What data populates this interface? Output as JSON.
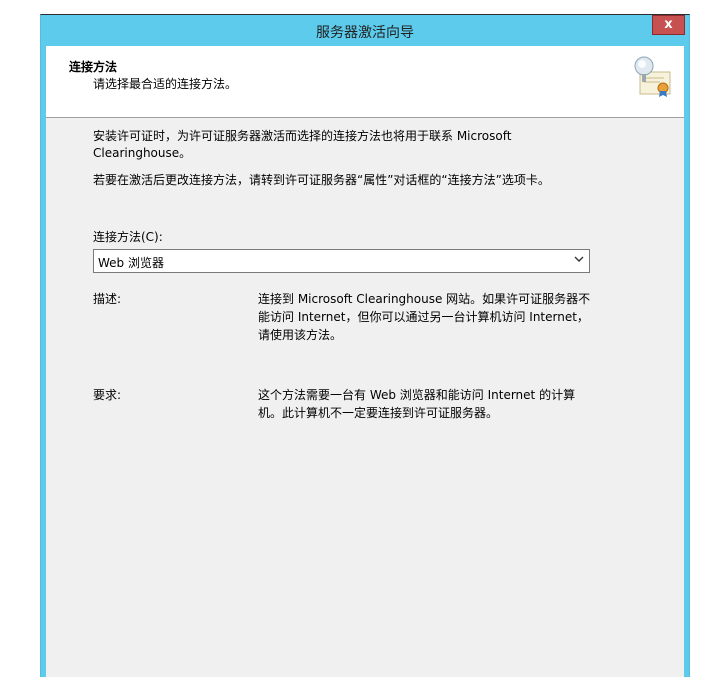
{
  "window": {
    "title": "服务器激活向导",
    "close_label": "x"
  },
  "header": {
    "title": "连接方法",
    "subtitle": "请选择最合适的连接方法。",
    "icon": "license-server-certificate-icon"
  },
  "content": {
    "paragraph1": "安装许可证时，为许可证服务器激活而选择的连接方法也将用于联系 Microsoft Clearinghouse。",
    "paragraph2": "若要在激活后更改连接方法，请转到许可证服务器“属性”对话框的“连接方法”选项卡。",
    "method_label": "连接方法(C):",
    "method_selected": "Web 浏览器",
    "description_label": "描述:",
    "description_text": "连接到 Microsoft Clearinghouse 网站。如果许可证服务器不能访问 Internet，但你可以通过另一台计算机访问 Internet，请使用该方法。",
    "requirement_label": "要求:",
    "requirement_text": "这个方法需要一台有 Web 浏览器和能访问 Internet 的计算机。此计算机不一定要连接到许可证服务器。"
  },
  "colors": {
    "titlebar": "#5ccbec",
    "close_button": "#c75050",
    "dialog_background": "#f0f0f0"
  }
}
